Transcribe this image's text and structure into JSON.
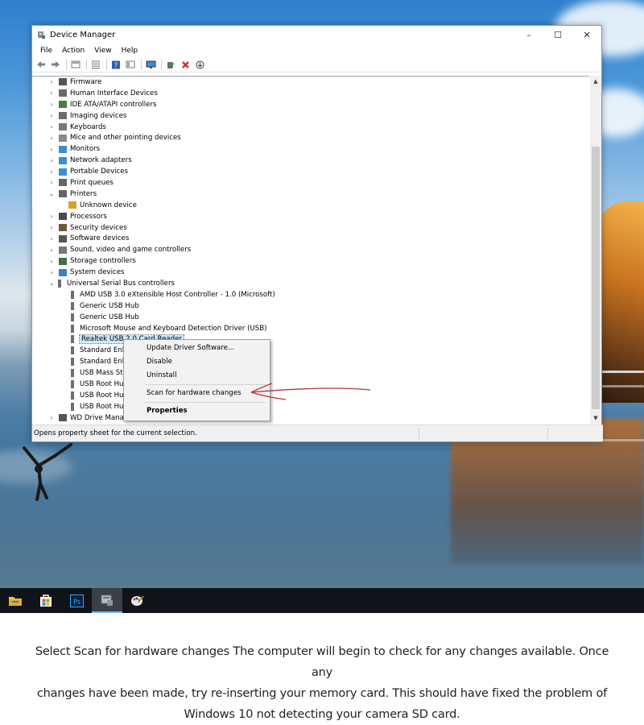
{
  "window": {
    "title": "Device Manager",
    "controls": {
      "minimize": "–",
      "maximize": "☐",
      "close": "✕"
    }
  },
  "menubar": [
    "File",
    "Action",
    "View",
    "Help"
  ],
  "toolbar_icons": [
    "back-icon",
    "forward-icon",
    "properties-icon",
    "list-icon",
    "help-icon",
    "view-icon",
    "monitor-icon",
    "update-driver-icon",
    "uninstall-icon",
    "download-icon"
  ],
  "tree": {
    "rows": [
      {
        "label": "Firmware",
        "level": 0,
        "expander": "›",
        "icon": "firmware-icon"
      },
      {
        "label": "Human Interface Devices",
        "level": 0,
        "expander": "›",
        "icon": "hid-icon"
      },
      {
        "label": "IDE ATA/ATAPI controllers",
        "level": 0,
        "expander": "›",
        "icon": "ide-icon"
      },
      {
        "label": "Imaging devices",
        "level": 0,
        "expander": "›",
        "icon": "camera-icon"
      },
      {
        "label": "Keyboards",
        "level": 0,
        "expander": "›",
        "icon": "keyboard-icon"
      },
      {
        "label": "Mice and other pointing devices",
        "level": 0,
        "expander": "›",
        "icon": "mouse-icon"
      },
      {
        "label": "Monitors",
        "level": 0,
        "expander": "›",
        "icon": "monitor-icon"
      },
      {
        "label": "Network adapters",
        "level": 0,
        "expander": "›",
        "icon": "network-icon"
      },
      {
        "label": "Portable Devices",
        "level": 0,
        "expander": "›",
        "icon": "portable-device-icon"
      },
      {
        "label": "Print queues",
        "level": 0,
        "expander": "›",
        "icon": "printer-icon"
      },
      {
        "label": "Printers",
        "level": 0,
        "expander": "⌄",
        "icon": "printer-icon"
      },
      {
        "label": "Unknown device",
        "level": 1,
        "expander": "",
        "icon": "unknown-device-icon"
      },
      {
        "label": "Processors",
        "level": 0,
        "expander": "›",
        "icon": "processor-icon"
      },
      {
        "label": "Security devices",
        "level": 0,
        "expander": "›",
        "icon": "security-icon"
      },
      {
        "label": "Software devices",
        "level": 0,
        "expander": "›",
        "icon": "software-icon"
      },
      {
        "label": "Sound, video and game controllers",
        "level": 0,
        "expander": "›",
        "icon": "sound-icon"
      },
      {
        "label": "Storage controllers",
        "level": 0,
        "expander": "›",
        "icon": "storage-icon"
      },
      {
        "label": "System devices",
        "level": 0,
        "expander": "›",
        "icon": "system-icon"
      },
      {
        "label": "Universal Serial Bus controllers",
        "level": 0,
        "expander": "⌄",
        "icon": "usb-icon"
      },
      {
        "label": "AMD USB 3.0 eXtensible Host Controller - 1.0 (Microsoft)",
        "level": 1,
        "expander": "",
        "icon": "usb-icon"
      },
      {
        "label": "Generic USB Hub",
        "level": 1,
        "expander": "",
        "icon": "usb-icon"
      },
      {
        "label": "Generic USB Hub",
        "level": 1,
        "expander": "",
        "icon": "usb-icon"
      },
      {
        "label": "Microsoft Mouse and Keyboard Detection Driver (USB)",
        "level": 1,
        "expander": "",
        "icon": "usb-icon"
      },
      {
        "label": "Realtek USB 2.0 Card Reader",
        "level": 1,
        "expander": "",
        "icon": "usb-icon",
        "selected": true
      },
      {
        "label": "Standard Enh",
        "level": 1,
        "expander": "",
        "icon": "usb-icon"
      },
      {
        "label": "Standard Enh",
        "level": 1,
        "expander": "",
        "icon": "usb-icon"
      },
      {
        "label": "USB Mass Sto",
        "level": 1,
        "expander": "",
        "icon": "usb-icon"
      },
      {
        "label": "USB Root Hu",
        "level": 1,
        "expander": "",
        "icon": "usb-icon"
      },
      {
        "label": "USB Root Hu",
        "level": 1,
        "expander": "",
        "icon": "usb-icon"
      },
      {
        "label": "USB Root Hu",
        "level": 1,
        "expander": "",
        "icon": "usb-icon"
      },
      {
        "label": "WD Drive Management devices",
        "level": 0,
        "expander": "›",
        "icon": "wd-drive-icon"
      }
    ]
  },
  "context_menu": {
    "update": "Update Driver Software...",
    "disable": "Disable",
    "uninstall": "Uninstall",
    "scan": "Scan for hardware changes",
    "properties": "Properties"
  },
  "statusbar": {
    "text": "Opens property sheet for the current selection."
  },
  "taskbar": [
    "file-explorer-icon",
    "store-icon",
    "photoshop-icon",
    "device-manager-icon",
    "paint-icon"
  ],
  "taskbar_ps": "Ps",
  "caption": {
    "line1": "Select Scan for hardware changes The computer will begin to check for any changes available.  Once any",
    "line2": "changes have been made, try re-inserting your memory card.  This should have fixed the problem of",
    "line3": "Windows 10 not detecting your camera SD card."
  },
  "colors": {
    "selection": "#cce8ff",
    "annotation_arrow": "#b23a3a",
    "taskbar": "#101318",
    "window_border": "#7a9cc0"
  }
}
